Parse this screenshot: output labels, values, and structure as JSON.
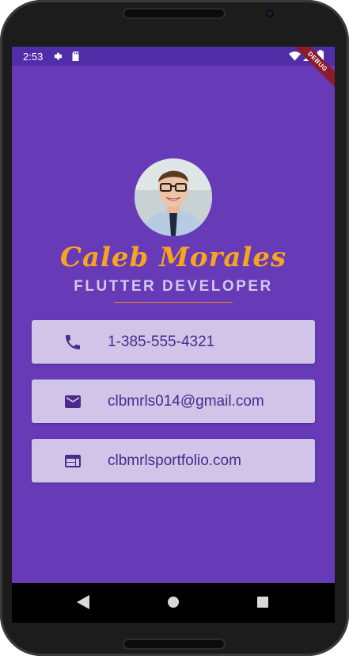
{
  "status_bar": {
    "time": "2:53",
    "left_icons": [
      "gear-icon",
      "sd-card-icon"
    ],
    "right_icons": [
      "wifi-icon",
      "signal-icon",
      "battery-icon"
    ]
  },
  "debug_banner": "DEBUG",
  "profile": {
    "name": "Caleb Morales",
    "title": "FLUTTER DEVELOPER"
  },
  "contacts": [
    {
      "icon": "phone-icon",
      "text": "1-385-555-4321"
    },
    {
      "icon": "email-icon",
      "text": "clbmrls014@gmail.com"
    },
    {
      "icon": "web-icon",
      "text": "clbmrlsportfolio.com"
    }
  ],
  "nav_bar": [
    "back-icon",
    "home-icon",
    "recents-icon"
  ],
  "colors": {
    "background": "#673ab7",
    "status_bar": "#512da8",
    "name": "#f7a51e",
    "card": "#d1c4e9",
    "card_text": "#4a2a8a"
  }
}
